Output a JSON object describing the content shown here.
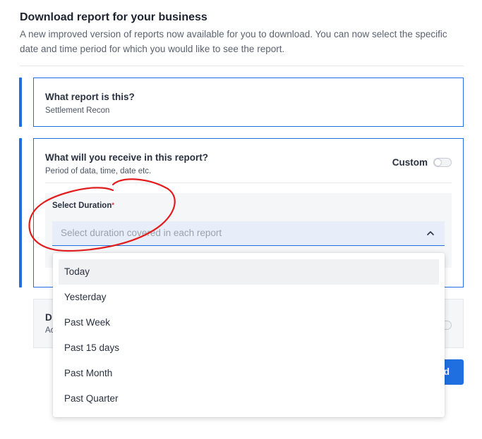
{
  "header": {
    "title": "Download report for your business",
    "description": "A new improved version of reports now available for you to download. You can now select the specific date and time period for which you would like to see the report."
  },
  "report_type": {
    "question": "What report is this?",
    "value": "Settlement Recon"
  },
  "receive": {
    "question": "What will you receive in this report?",
    "subtitle": "Period of data, time, date etc.",
    "custom_label": "Custom",
    "custom_enabled": false
  },
  "duration": {
    "label": "Select Duration",
    "required_mark": "*",
    "placeholder": "Select duration covered in each report",
    "options": [
      "Today",
      "Yesterday",
      "Past Week",
      "Past 15 days",
      "Past Month",
      "Past Quarter"
    ],
    "highlighted_index": 0
  },
  "third_card": {
    "title_fragment": "D",
    "subtitle_fragment": "Ac"
  },
  "actions": {
    "submit_fragment": "d"
  },
  "colors": {
    "accent": "#1f6fe0",
    "annotation": "#e11d1d"
  }
}
